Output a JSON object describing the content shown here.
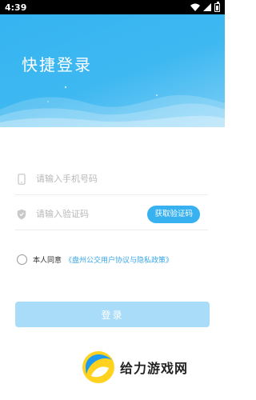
{
  "status_bar": {
    "time": "4:39",
    "icons": [
      "wifi-icon",
      "signal-icon",
      "battery-icon"
    ]
  },
  "hero": {
    "title": "快捷登录",
    "colors": {
      "top": "#34b4f1",
      "bottom": "#7ecff5"
    }
  },
  "form": {
    "phone": {
      "placeholder": "请输入手机号码",
      "value": "",
      "icon": "phone-icon"
    },
    "code": {
      "placeholder": "请输入验证码",
      "value": "",
      "icon": "shield-icon",
      "button_label": "获取验证码"
    }
  },
  "agreement": {
    "checked": false,
    "prefix": "本人同意",
    "link": "《盘州公交用户协议与隐私政策》"
  },
  "login": {
    "label": "登录"
  },
  "watermark": {
    "text": "给力游戏网"
  },
  "colors": {
    "accent": "#37b1ef",
    "login_disabled": "#a9dcf8",
    "link": "#3aa6e8"
  }
}
